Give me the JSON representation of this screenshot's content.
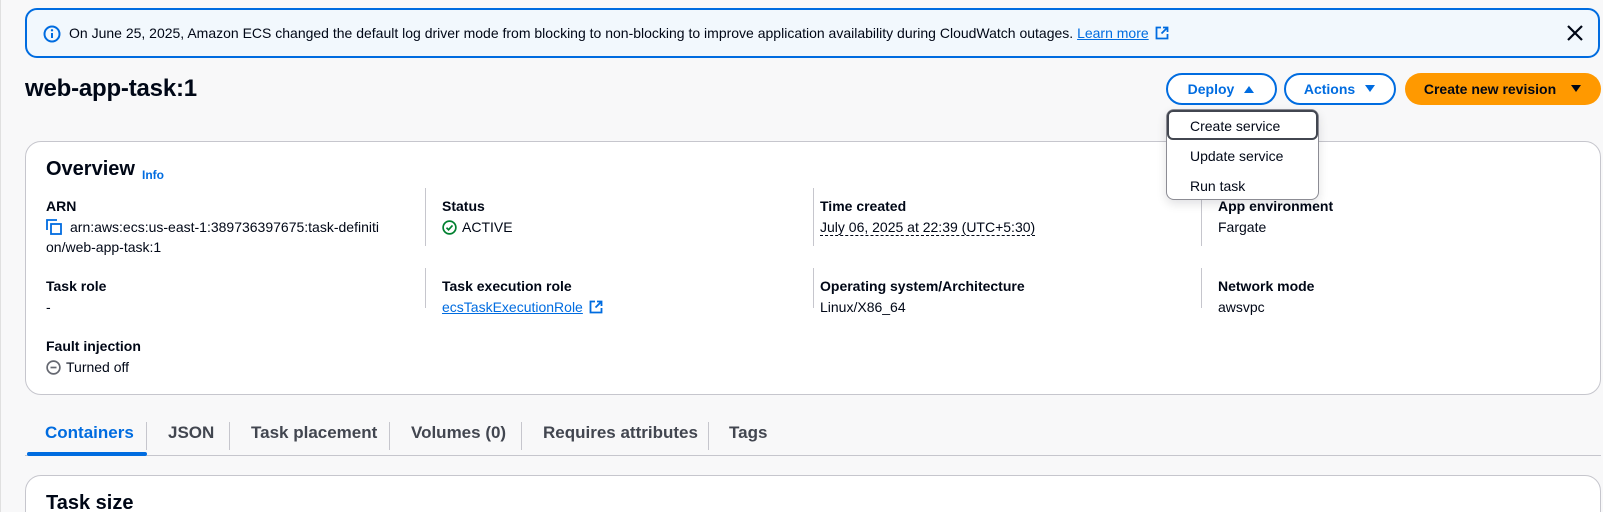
{
  "banner": {
    "message": "On June 25, 2025, Amazon ECS changed the default log driver mode from blocking to non-blocking to improve application availability during CloudWatch outages.",
    "link_label": "Learn more",
    "icon": "info-icon",
    "close_icon": "close-icon"
  },
  "header": {
    "title": "web-app-task:1",
    "deploy_label": "Deploy",
    "actions_label": "Actions",
    "create_label": "Create new revision"
  },
  "deploy_menu": {
    "items": [
      "Create service",
      "Update service",
      "Run task"
    ],
    "highlighted": "Create service"
  },
  "overview": {
    "title": "Overview",
    "info_label": "Info",
    "fields": {
      "arn": {
        "label": "ARN",
        "value": "arn:aws:ecs:us-east-1:389736397675:task-definiti",
        "value_cont": "on/web-app-task:1"
      },
      "status": {
        "label": "Status",
        "value": "ACTIVE"
      },
      "time_created": {
        "label": "Time created",
        "value": "July 06, 2025 at 22:39 (UTC+5:30)"
      },
      "app_environment": {
        "label": "App environment",
        "value": "Fargate"
      },
      "task_role": {
        "label": "Task role",
        "value": "-"
      },
      "task_execution_role": {
        "label": "Task execution role",
        "value": "ecsTaskExecutionRole"
      },
      "os_arch": {
        "label": "Operating system/Architecture",
        "value": "Linux/X86_64"
      },
      "network_mode": {
        "label": "Network mode",
        "value": "awsvpc"
      },
      "fault_injection": {
        "label": "Fault injection",
        "value": "Turned off"
      }
    }
  },
  "tabs": {
    "items": [
      "Containers",
      "JSON",
      "Task placement",
      "Volumes (0)",
      "Requires attributes",
      "Tags"
    ],
    "active": "Containers"
  },
  "task_size": {
    "title": "Task size"
  },
  "colors": {
    "accent": "#006ce0",
    "primary_button": "#ff9900",
    "success": "#00802f",
    "banner_bg": "#f2f8fd"
  }
}
